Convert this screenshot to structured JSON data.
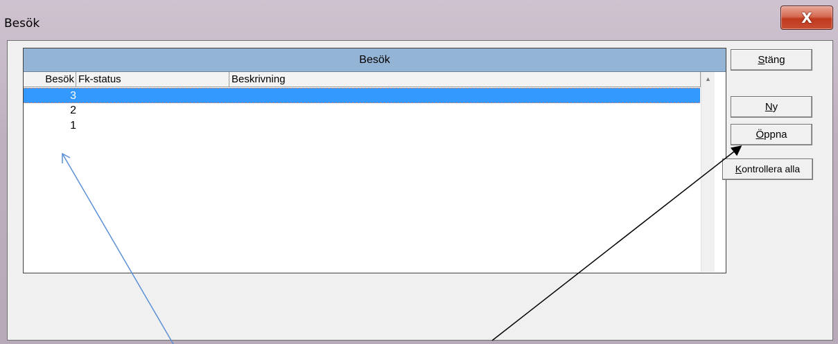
{
  "window": {
    "title": "Besök",
    "close_glyph": "X"
  },
  "grid": {
    "caption": "Besök",
    "columns": [
      "Besök",
      "Fk-status",
      "Beskrivning"
    ],
    "rows": [
      {
        "besok": "3",
        "fk_status": "",
        "beskrivning": "",
        "selected": true
      },
      {
        "besok": "2",
        "fk_status": "",
        "beskrivning": "",
        "selected": false
      },
      {
        "besok": "1",
        "fk_status": "",
        "beskrivning": "",
        "selected": false
      }
    ],
    "scroll_up_icon": "triangle-up-icon"
  },
  "buttons": {
    "stang": {
      "mnemonic": "S",
      "rest": "täng"
    },
    "ny": {
      "mnemonic": "N",
      "rest": "y"
    },
    "oppna": {
      "mnemonic": "Ö",
      "rest": "ppna"
    },
    "kontrollera": {
      "mnemonic": "K",
      "rest": "ontrollera alla"
    }
  },
  "colors": {
    "selection": "#3399ff",
    "caption_bar": "#93b4d5",
    "annotation_blue_arrow": "#5b8fd6",
    "annotation_black_arrow": "#000000"
  }
}
